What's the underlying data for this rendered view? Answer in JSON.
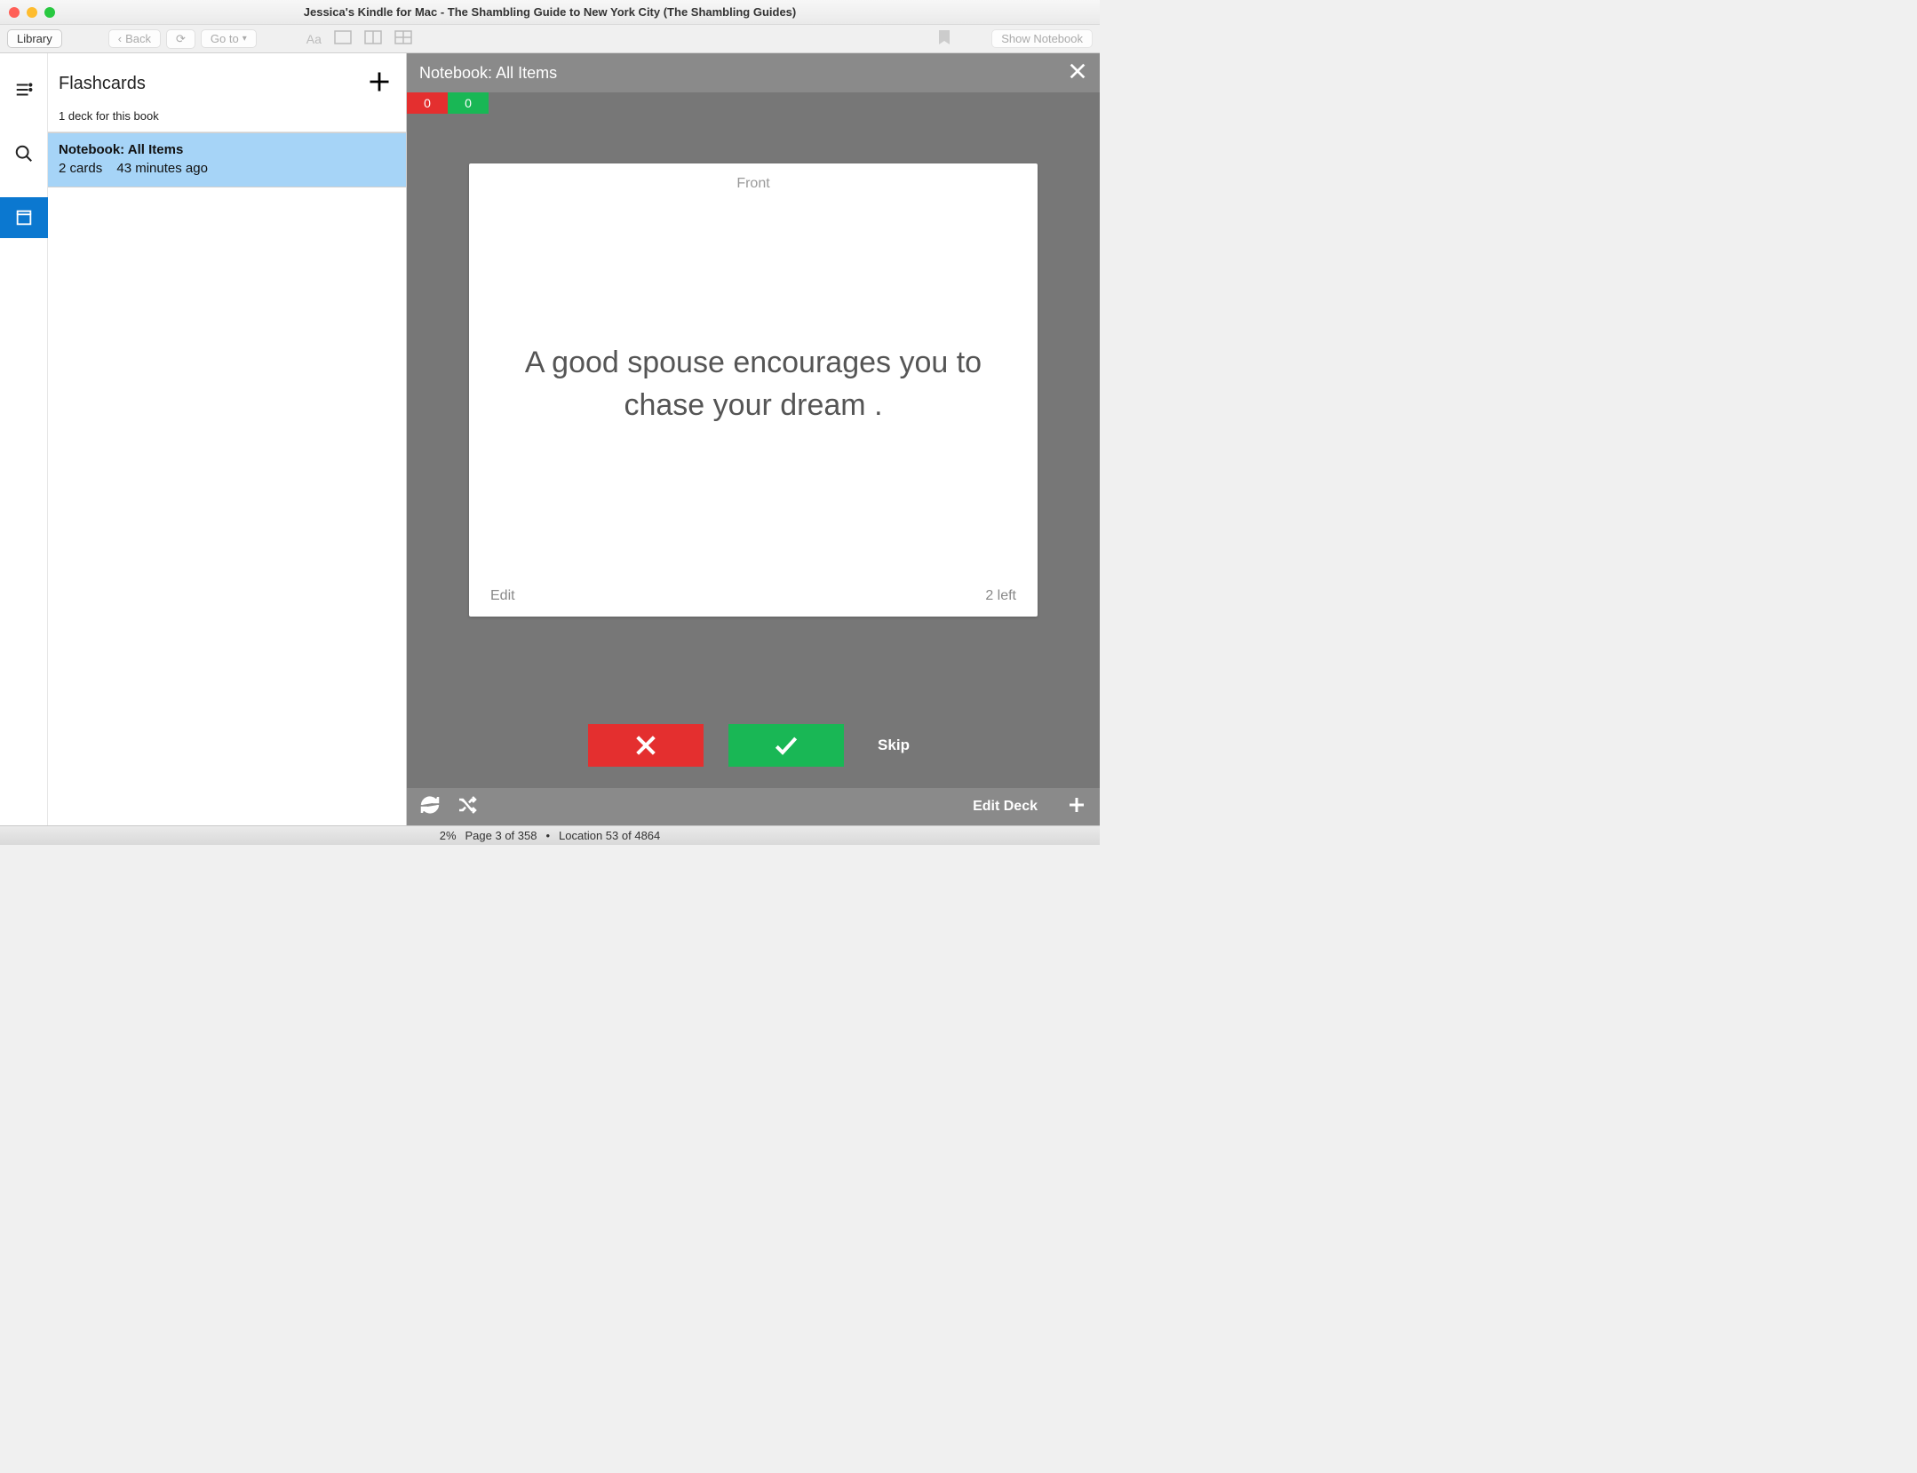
{
  "window": {
    "title": "Jessica's Kindle for Mac - The Shambling Guide to New York City (The Shambling Guides)"
  },
  "toolbar": {
    "library": "Library",
    "back": "Back",
    "goto": "Go to",
    "show_notebook": "Show Notebook"
  },
  "sidebar": {
    "title": "Flashcards",
    "deck_count": "1 deck for this book",
    "deck": {
      "title": "Notebook: All Items",
      "cards": "2 cards",
      "time": "43 minutes ago"
    }
  },
  "flashcards": {
    "header": "Notebook: All Items",
    "score_wrong": "0",
    "score_right": "0",
    "card": {
      "side_label": "Front",
      "text": "A good spouse encourages you to chase your dream .",
      "edit": "Edit",
      "remaining": "2 left"
    },
    "skip": "Skip",
    "edit_deck": "Edit Deck"
  },
  "status": {
    "percent": "2%",
    "page": "Page 3 of 358",
    "sep": "•",
    "location": "Location 53 of 4864"
  }
}
